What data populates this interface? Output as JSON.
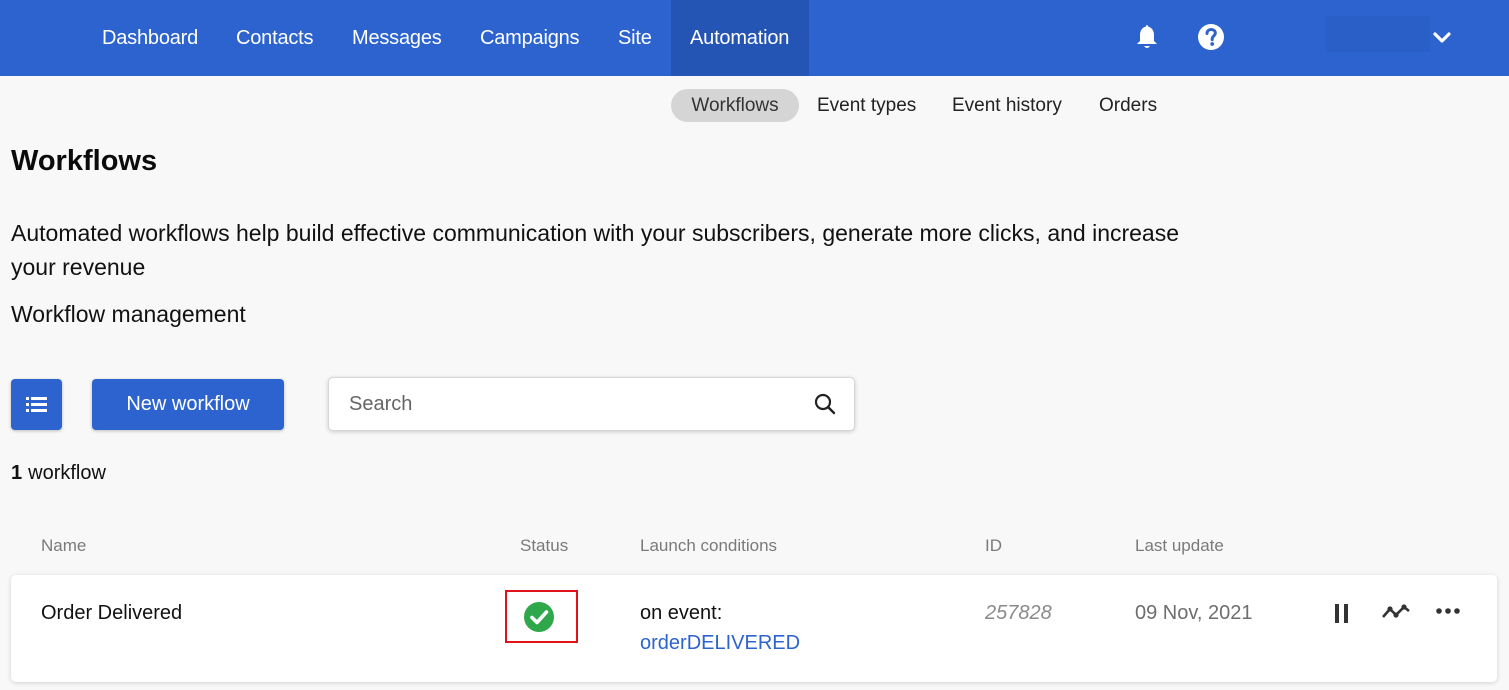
{
  "nav": {
    "items": [
      {
        "label": "Dashboard"
      },
      {
        "label": "Contacts"
      },
      {
        "label": "Messages"
      },
      {
        "label": "Campaigns"
      },
      {
        "label": "Site"
      },
      {
        "label": "Automation",
        "active": true
      }
    ],
    "icons": [
      "bell-icon",
      "help-icon",
      "chevron-down-icon"
    ]
  },
  "subnav": {
    "items": [
      {
        "label": "Workflows",
        "active": true
      },
      {
        "label": "Event types"
      },
      {
        "label": "Event history"
      },
      {
        "label": "Orders"
      }
    ]
  },
  "page": {
    "title": "Workflows",
    "intro": "Automated workflows help build effective communication with your subscribers, generate more clicks, and increase your revenue",
    "section_label": "Workflow management"
  },
  "toolbar": {
    "new_workflow_label": "New workflow",
    "search_placeholder": "Search",
    "icons": [
      "list-view-icon",
      "search-icon"
    ]
  },
  "summary": {
    "count": "1",
    "unit": "workflow"
  },
  "table": {
    "columns": [
      "Name",
      "Status",
      "Launch conditions",
      "ID",
      "Last update"
    ],
    "rows": [
      {
        "name": "Order Delivered",
        "status": "active",
        "condition_prefix": "on event:",
        "condition_event": "orderDELIVERED",
        "id": "257828",
        "last_update": "09 Nov, 2021"
      }
    ],
    "row_actions": [
      "pause-icon",
      "stats-icon",
      "more-icon"
    ]
  },
  "colors": {
    "primary": "#2d63cf",
    "status_ok": "#2ea84a",
    "highlight": "#e0131b"
  }
}
